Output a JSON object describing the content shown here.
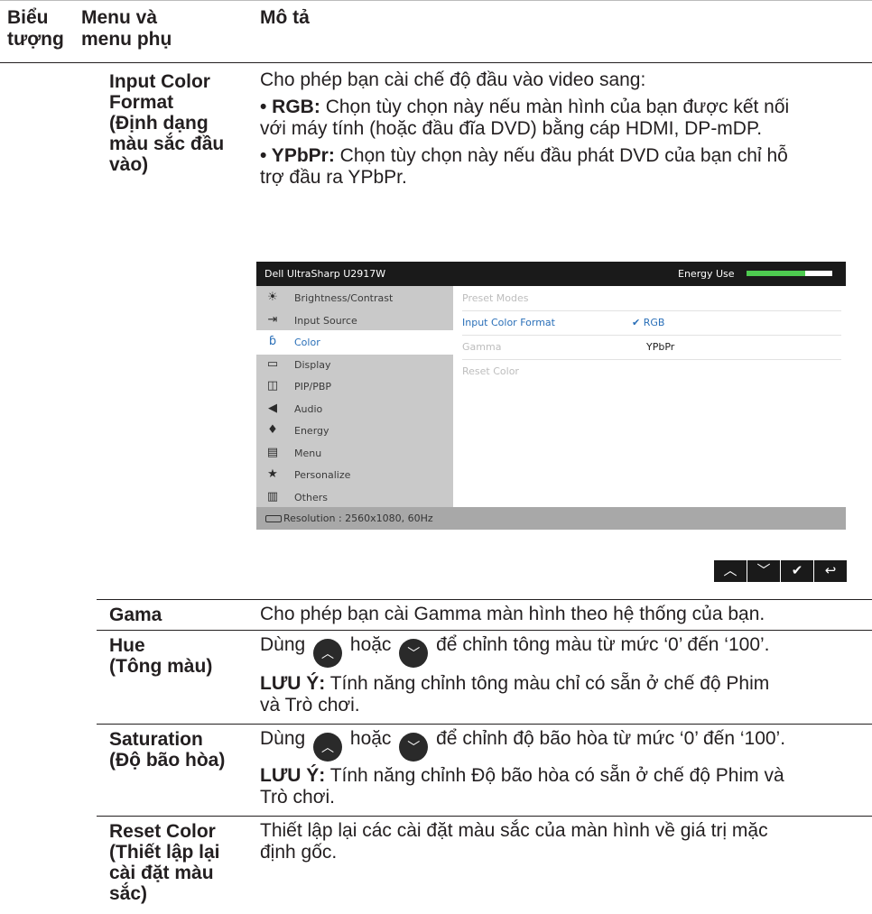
{
  "header": {
    "col1": [
      "Biểu",
      "tượng"
    ],
    "col2": [
      "Menu và",
      "menu phụ"
    ],
    "col3": "Mô tả"
  },
  "input_color_format": {
    "menu_lines": [
      "Input Color",
      "Format",
      "(Định dạng",
      "màu sắc đầu",
      "vào)"
    ],
    "intro": "Cho phép bạn cài chế độ đầu vào video sang:",
    "rgb_label": "• RGB:",
    "rgb_lines": [
      " Chọn tùy chọn này nếu màn hình của bạn được kết nối",
      "với máy tính (hoặc đầu đĩa DVD) bằng cáp HDMI, DP-mDP."
    ],
    "ypbpr_label": "• YPbPr:",
    "ypbpr_lines": [
      " Chọn tùy chọn này nếu đầu phát DVD của bạn chỉ hỗ",
      "trợ đầu ra YPbPr."
    ]
  },
  "osd": {
    "title": "Dell UltraSharp U2917W",
    "energy_label": "Energy Use",
    "energy_level": 0.68,
    "energy_color": "#4ecb50",
    "menu_items": [
      {
        "label": "Brightness/Contrast",
        "icon": "sun-icon"
      },
      {
        "label": "Input Source",
        "icon": "input-source-icon"
      },
      {
        "label": "Color",
        "icon": "color-icon"
      },
      {
        "label": "Display",
        "icon": "display-icon"
      },
      {
        "label": "PIP/PBP",
        "icon": "pip-icon"
      },
      {
        "label": "Audio",
        "icon": "speaker-icon"
      },
      {
        "label": "Energy",
        "icon": "energy-icon"
      },
      {
        "label": "Menu",
        "icon": "menu-icon"
      },
      {
        "label": "Personalize",
        "icon": "star-icon"
      },
      {
        "label": "Others",
        "icon": "others-icon"
      }
    ],
    "active_item": "Color",
    "submenu": [
      "Preset Modes",
      "Input Color Format",
      "Gamma",
      "Reset Color"
    ],
    "options": [
      "RGB",
      "YPbPr"
    ],
    "selected_option": "RGB",
    "status": "Resolution : 2560x1080, 60Hz",
    "accent_color": "#2a6fb8"
  },
  "nav_buttons": [
    {
      "glyph": "︿",
      "icon": "up-arrow-icon"
    },
    {
      "glyph": "﹀",
      "icon": "down-arrow-icon"
    },
    {
      "glyph": "✔",
      "icon": "check-icon"
    },
    {
      "glyph": "↩",
      "icon": "back-icon"
    }
  ],
  "gama": {
    "menu": "Gama",
    "desc": "Cho phép bạn cài Gamma màn hình theo hệ thống của bạn."
  },
  "hue": {
    "menu_lines": [
      "Hue",
      "(Tông màu)"
    ],
    "desc_pre": "Dùng",
    "desc_mid": "hoặc",
    "desc_post": "để chỉnh tông màu từ mức ‘0’ đến ‘100’.",
    "note_label": "LƯU Ý:",
    "note_lines": [
      " Tính năng chỉnh tông màu chỉ có sẵn ở chế độ Phim",
      "và Trò chơi."
    ]
  },
  "saturation": {
    "menu_lines": [
      "Saturation",
      "(Độ bão hòa)"
    ],
    "desc_pre": "Dùng",
    "desc_mid": "hoặc",
    "desc_post": "để chỉnh độ bão hòa từ mức ‘0’ đến ‘100’.",
    "note_label": "LƯU Ý:",
    "note_lines": [
      " Tính năng chỉnh Độ bão hòa có sẵn ở chế độ Phim và",
      "Trò chơi."
    ]
  },
  "reset_color": {
    "menu_lines": [
      "Reset Color",
      "(Thiết lập lại",
      "cài đặt màu",
      "sắc)"
    ],
    "desc_lines": [
      "Thiết lập lại các cài đặt màu sắc của màn hình về giá trị mặc",
      "định gốc."
    ]
  }
}
